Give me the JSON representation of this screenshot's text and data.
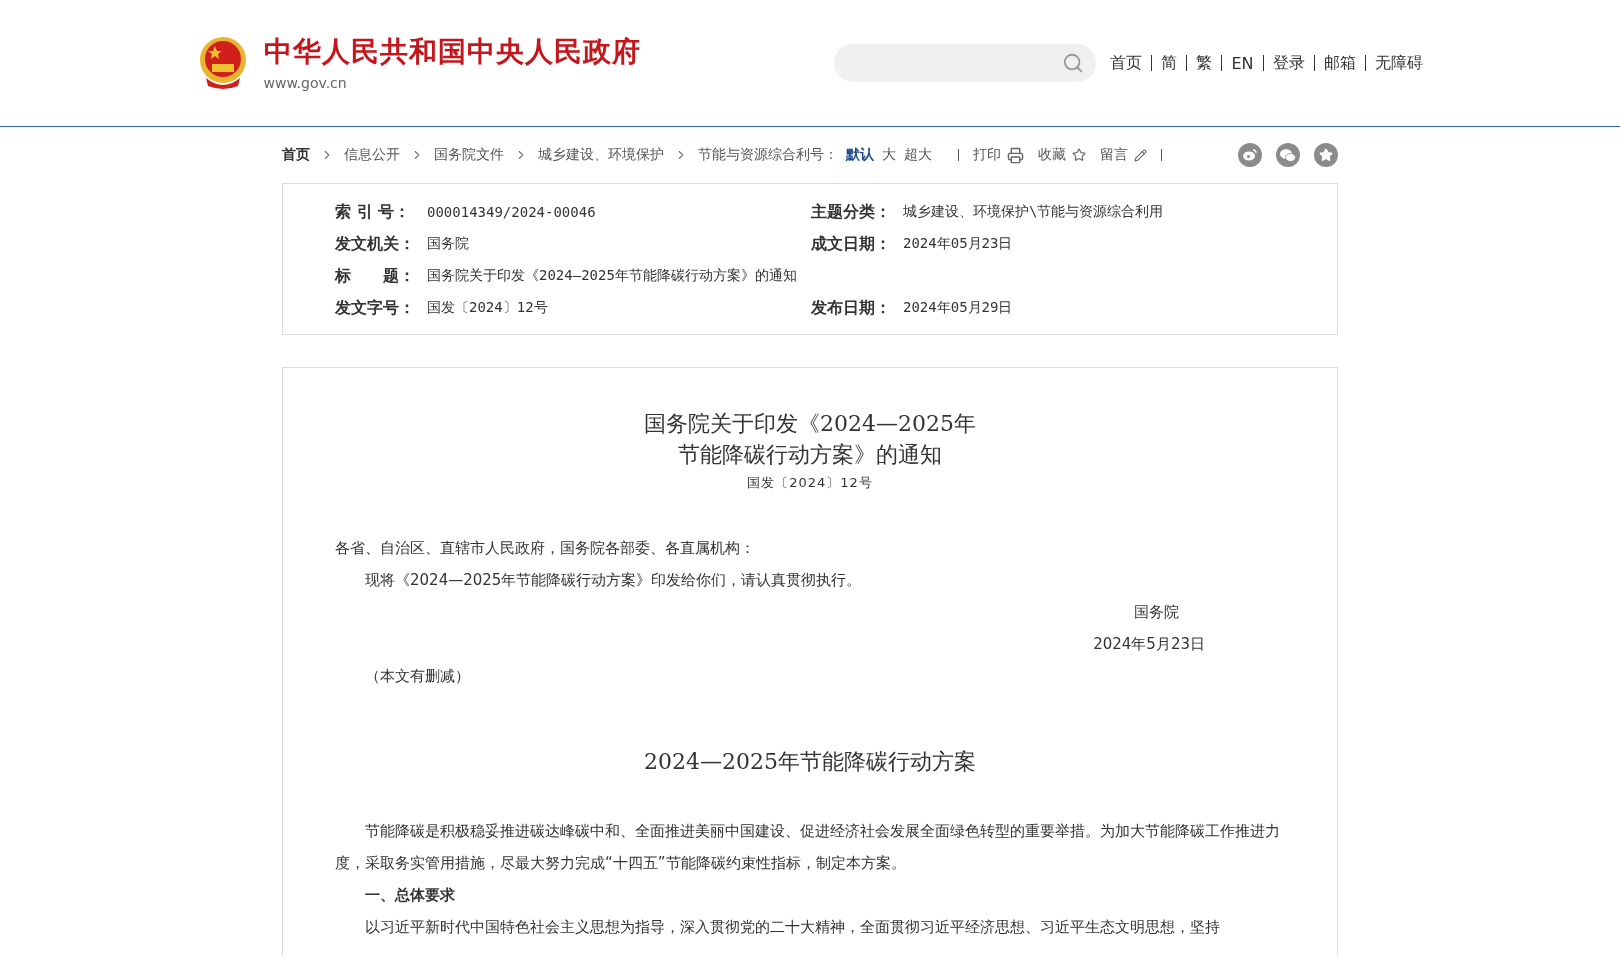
{
  "header": {
    "site_name": "中华人民共和国中央人民政府",
    "domain": "www.gov.cn",
    "nav": [
      "首页",
      "简",
      "繁",
      "EN",
      "登录",
      "邮箱",
      "无障碍"
    ]
  },
  "breadcrumb": [
    "首页",
    "信息公开",
    "国务院文件",
    "城乡建设、环境保护",
    "节能与资源综合利"
  ],
  "font_size": {
    "label": "号：",
    "options": [
      {
        "label": "默认",
        "selected": true
      },
      {
        "label": "大",
        "selected": false
      },
      {
        "label": "超大",
        "selected": false
      }
    ]
  },
  "tools": [
    {
      "label": "打印",
      "kind": "print"
    },
    {
      "label": "收藏",
      "kind": "star"
    },
    {
      "label": "留言",
      "kind": "pencil"
    }
  ],
  "share": [
    {
      "kind": "weibo"
    },
    {
      "kind": "wechat"
    },
    {
      "kind": "favorite"
    }
  ],
  "meta": [
    {
      "label": "索 引 号：",
      "value": "000014349/2024-00046",
      "kind": "half"
    },
    {
      "label": "主题分类：",
      "value": "城乡建设、环境保护\\节能与资源综合利用",
      "kind": "half"
    },
    {
      "label": "发文机关：",
      "value": "国务院",
      "kind": "half"
    },
    {
      "label": "成文日期：",
      "value": "2024年05月23日",
      "kind": "half"
    },
    {
      "label": "标　　题：",
      "value": "国务院关于印发《2024—2025年节能降碳行动方案》的通知",
      "kind": "full"
    },
    {
      "label": "发文字号：",
      "value": "国发〔2024〕12号",
      "kind": "half"
    },
    {
      "label": "发布日期：",
      "value": "2024年05月29日",
      "kind": "half"
    }
  ],
  "article": {
    "title": [
      "国务院关于印发《2024—2025年",
      "节能降碳行动方案》的通知"
    ],
    "doc_number": "国发〔2024〕12号",
    "blocks": [
      {
        "kind": "plain",
        "text": "各省、自治区、直辖市人民政府，国务院各部委、各直属机构："
      },
      {
        "kind": "indent",
        "text": "现将《2024—2025年节能降碳行动方案》印发给你们，请认真贯彻执行。"
      },
      {
        "kind": "sign",
        "text": "国务院"
      },
      {
        "kind": "sign",
        "text": "2024年5月23日"
      },
      {
        "kind": "indent",
        "text": "（本文有删减）"
      },
      {
        "kind": "subtitle",
        "text": "2024—2025年节能降碳行动方案"
      },
      {
        "kind": "indent",
        "text": "节能降碳是积极稳妥推进碳达峰碳中和、全面推进美丽中国建设、促进经济社会发展全面绿色转型的重要举措。为加大节能降碳工作推进力度，采取务实管用措施，尽最大努力完成“十四五”节能降碳约束性指标，制定本方案。"
      },
      {
        "kind": "heading",
        "text": "一、总体要求"
      },
      {
        "kind": "indent",
        "text": "以习近平新时代中国特色社会主义思想为指导，深入贯彻党的二十大精神，全面贯彻习近平经济思想、习近平生态文明思想，坚持"
      }
    ]
  }
}
